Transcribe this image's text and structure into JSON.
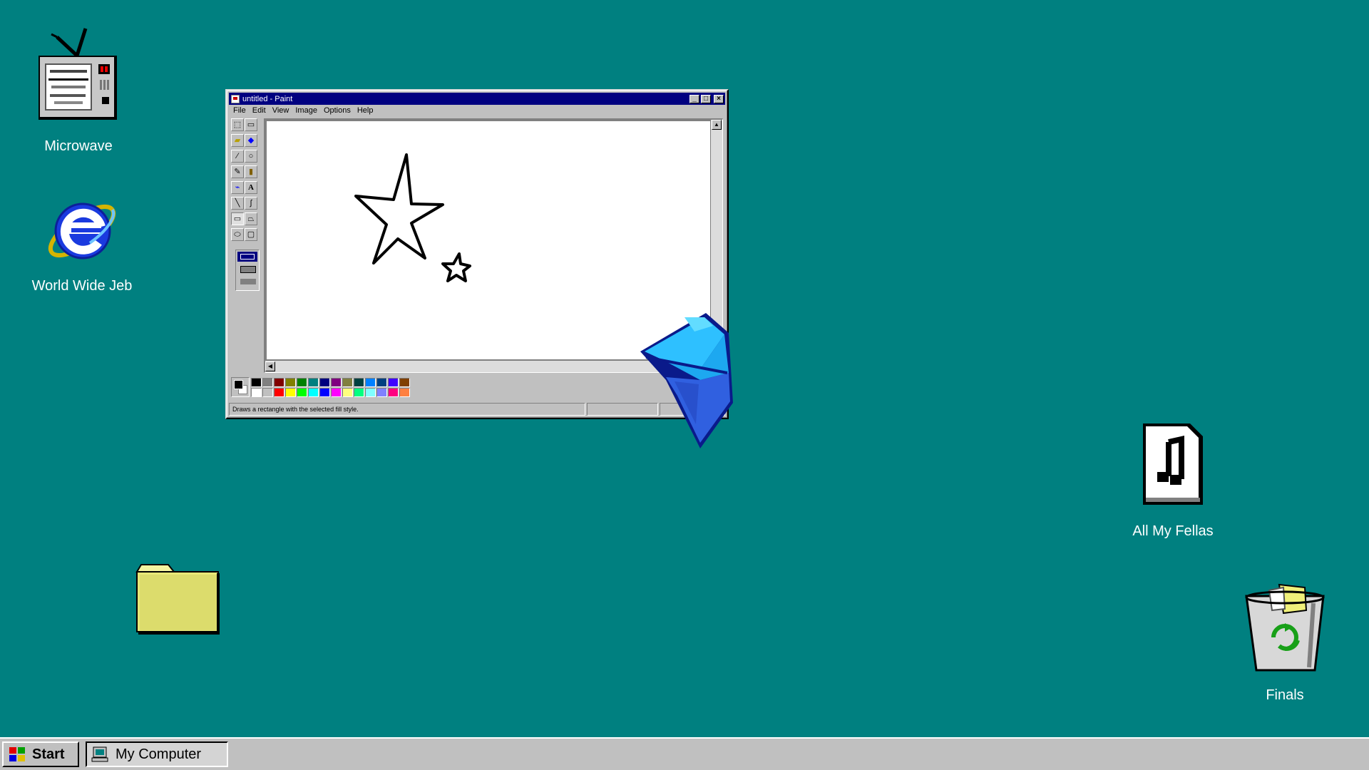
{
  "desktop": {
    "background_color": "#008080",
    "icons": [
      {
        "name": "microwave",
        "label": "Microwave",
        "icon": "microwave-tv-icon"
      },
      {
        "name": "world-wide-jeb",
        "label": "World Wide Jeb",
        "icon": "internet-explorer-icon"
      },
      {
        "name": "folder",
        "label": "",
        "icon": "folder-icon"
      },
      {
        "name": "all-my-fellas",
        "label": "All My Fellas",
        "icon": "music-file-icon"
      },
      {
        "name": "finals",
        "label": "Finals",
        "icon": "recycle-bin-icon"
      }
    ]
  },
  "paint_window": {
    "title": "untitled - Paint",
    "menu": [
      "File",
      "Edit",
      "View",
      "Image",
      "Options",
      "Help"
    ],
    "status_text": "Draws a rectangle with the selected fill style.",
    "palette_row1": [
      "#000000",
      "#808080",
      "#800000",
      "#808000",
      "#008000",
      "#008080",
      "#000080",
      "#800080",
      "#808040",
      "#004040",
      "#0080ff",
      "#004080",
      "#4000ff",
      "#804000"
    ],
    "palette_row2": [
      "#ffffff",
      "#c0c0c0",
      "#ff0000",
      "#ffff00",
      "#00ff00",
      "#00ffff",
      "#0000ff",
      "#ff00ff",
      "#ffff80",
      "#00ff80",
      "#80ffff",
      "#8080ff",
      "#ff0080",
      "#ff8040"
    ]
  },
  "taskbar": {
    "start_label": "Start",
    "tasks": [
      {
        "label": "My Computer",
        "icon": "computer-icon"
      }
    ]
  }
}
